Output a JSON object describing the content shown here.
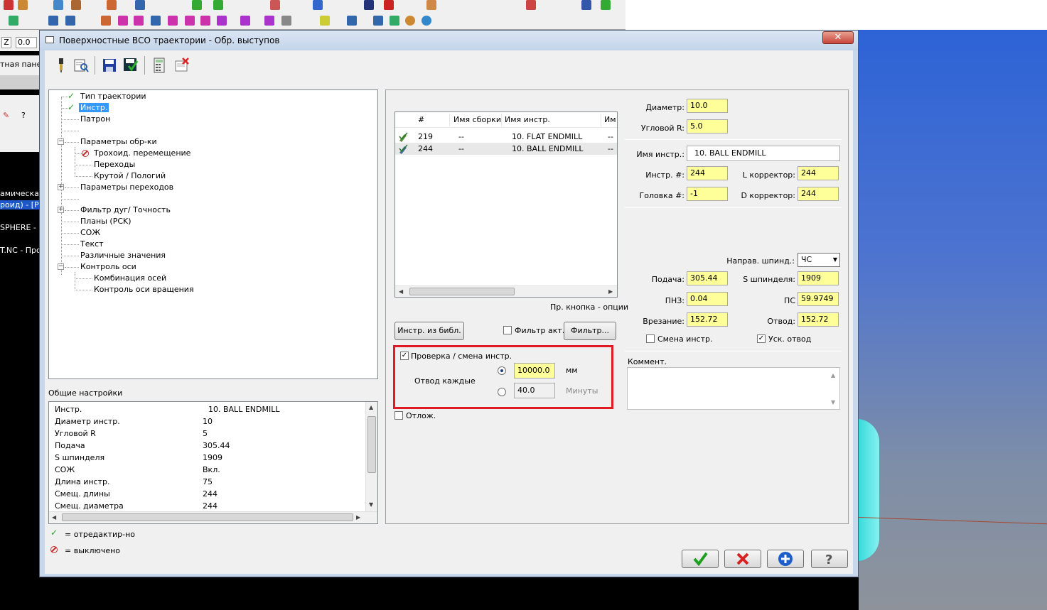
{
  "app": {
    "left_strip": {
      "z_label": "Z",
      "z_value": "0.0",
      "panel_text": "тная панел",
      "items": [
        "амическая",
        "роид) - [PCK",
        "SPHERE -",
        "T.NC - Про"
      ]
    }
  },
  "dialog": {
    "title": "Поверхностные ВСО траектории - Обр. выступов",
    "close_label": "✕",
    "toolbar": {
      "icons": [
        "tool-icon",
        "preview-icon",
        "save-icon",
        "save-all-icon",
        "calculator-icon",
        "delete-icon"
      ]
    },
    "tree": {
      "items": [
        {
          "label": "Тип траектории",
          "status": "edited"
        },
        {
          "label": "Инстр.",
          "status": "edited",
          "selected": true
        },
        {
          "label": "Патрон",
          "status": ""
        },
        {
          "label": "Параметры обр-ки",
          "status": "",
          "expander": "-"
        },
        {
          "label": "Трохоид. перемещение",
          "status": "disabled"
        },
        {
          "label": "Переходы",
          "status": ""
        },
        {
          "label": "Крутой / Пологий",
          "status": ""
        },
        {
          "label": "Параметры переходов",
          "status": "",
          "expander": "+"
        },
        {
          "label": "Фильтр дуг/ Точность",
          "status": "",
          "expander": "+"
        },
        {
          "label": "Планы (PCK)",
          "status": ""
        },
        {
          "label": "СОЖ",
          "status": ""
        },
        {
          "label": "Текст",
          "status": ""
        },
        {
          "label": "Различные значения",
          "status": ""
        },
        {
          "label": "Контроль оси",
          "status": "",
          "expander": "-"
        },
        {
          "label": "Комбинация осей",
          "status": ""
        },
        {
          "label": "Контроль оси вращения",
          "status": ""
        }
      ]
    },
    "general": {
      "title": "Общие настройки",
      "rows": [
        {
          "name": "Инстр.",
          "value": "10. BALL ENDMILL"
        },
        {
          "name": "Диаметр инстр.",
          "value": "10"
        },
        {
          "name": "Угловой R",
          "value": "5"
        },
        {
          "name": "Подача",
          "value": "305.44"
        },
        {
          "name": "S шпинделя",
          "value": "1909"
        },
        {
          "name": "СОЖ",
          "value": "Вкл."
        },
        {
          "name": "Длина инстр.",
          "value": "75"
        },
        {
          "name": "Смещ. длины",
          "value": "244"
        },
        {
          "name": "Смещ. диаметра",
          "value": "244"
        }
      ]
    },
    "legend": {
      "edited": "= отредактир-но",
      "disabled": "= выключено"
    },
    "tool_list": {
      "headers": [
        "#",
        "Имя сборки",
        "Имя инстр.",
        "Им"
      ],
      "rows": [
        {
          "num": "219",
          "assembly": "--",
          "name": "10. FLAT ENDMILL",
          "extra": "--"
        },
        {
          "num": "244",
          "assembly": "--",
          "name": "10. BALL ENDMILL",
          "extra": "--"
        }
      ],
      "hint": "Пр. кнопка - опции"
    },
    "buttons": {
      "from_library": "Инстр. из библ.",
      "filter_active": "Фильтр акт.",
      "filter": "Фильтр..."
    },
    "check_group": {
      "enabled_label": "Проверка / смена инстр.",
      "retract_every": "Отвод каждые",
      "distance_value": "10000.0",
      "distance_unit": "мм",
      "time_value": "40.0",
      "time_unit": "Минуты",
      "distance_selected": true
    },
    "defer_label": "Отлож.",
    "params": {
      "diameter_label": "Диаметр:",
      "diameter": "10.0",
      "corner_r_label": "Угловой R:",
      "corner_r": "5.0",
      "tool_name_label": "Имя инстр.:",
      "tool_name": "10. BALL ENDMILL",
      "tool_num_label": "Инстр. #:",
      "tool_num": "244",
      "l_corr_label": "L корректор:",
      "l_corr": "244",
      "head_label": "Головка #:",
      "head": "-1",
      "d_corr_label": "D корректор:",
      "d_corr": "244",
      "spindle_dir_label": "Направ. шпинд.:",
      "spindle_dir": "ЧС",
      "feed_label": "Подача:",
      "feed": "305.44",
      "spindle_label": "S шпинделя:",
      "spindle": "1909",
      "plunge_label": "ПНЗ:",
      "plunge": "0.04",
      "ps_label": "ПС",
      "ps": "59.9749",
      "entry_label": "Врезание:",
      "entry": "152.72",
      "retract_label": "Отвод:",
      "retract": "152.72",
      "tool_change_label": "Смена инстр.",
      "tool_change_checked": false,
      "fast_retract_label": "Уск. отвод",
      "fast_retract_checked": true,
      "comment_label": "Коммент.",
      "comment": ""
    },
    "footer": {
      "icons": [
        "ok-check-icon",
        "cancel-x-icon",
        "add-plus-icon",
        "help-question-icon"
      ]
    }
  }
}
